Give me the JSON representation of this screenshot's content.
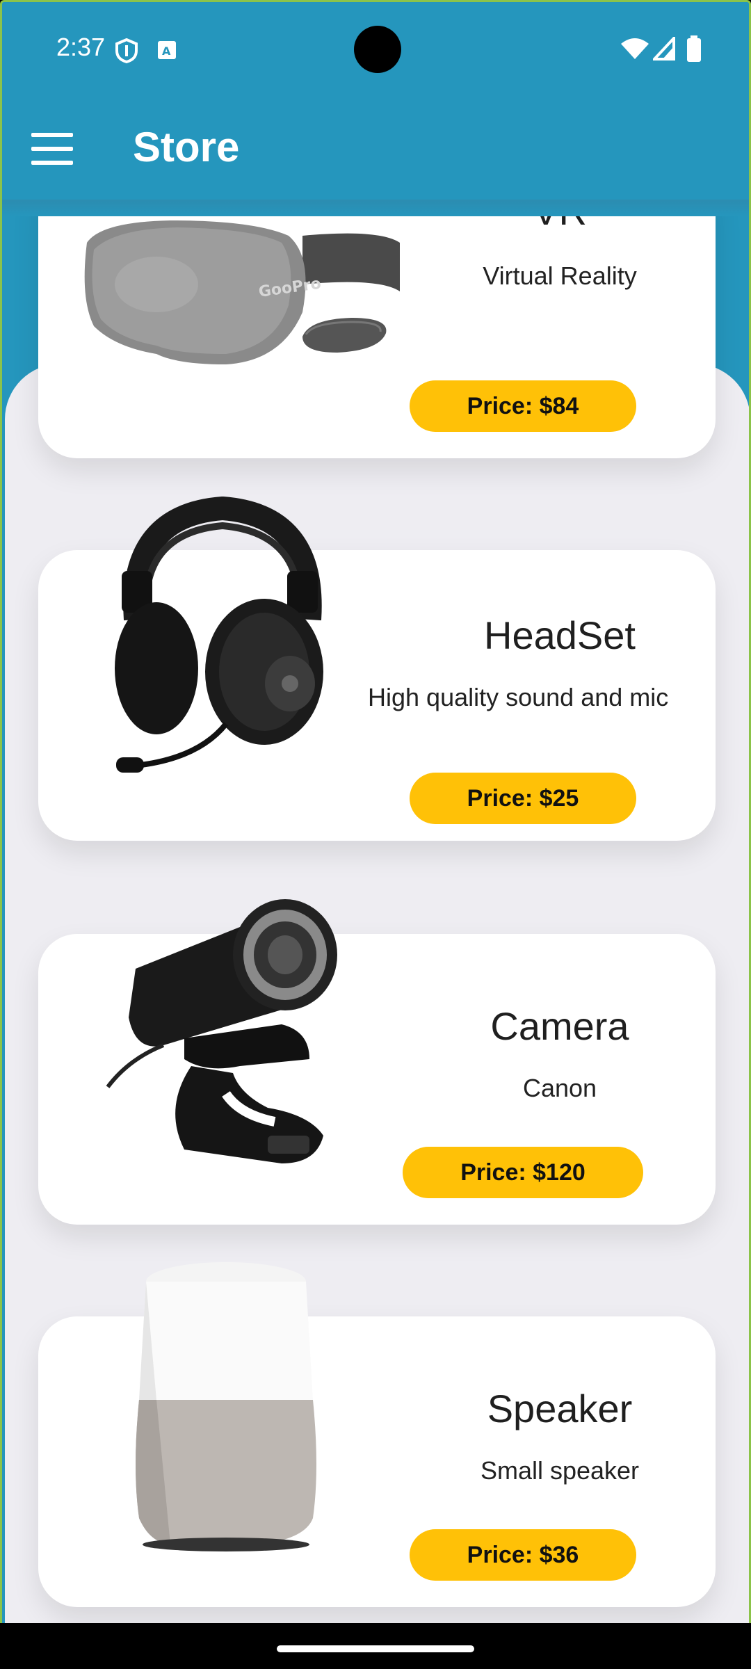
{
  "status_bar": {
    "time": "2:37"
  },
  "app_bar": {
    "title": "Store"
  },
  "products": [
    {
      "name": "VR",
      "description": "Virtual Reality",
      "price": "Price: $84",
      "image_icon": "vr-headset-icon"
    },
    {
      "name": "HeadSet",
      "description": "High quality sound and mic",
      "price": "Price: $25",
      "image_icon": "headset-icon"
    },
    {
      "name": "Camera",
      "description": "Canon",
      "price": "Price: $120",
      "image_icon": "webcam-icon"
    },
    {
      "name": "Speaker",
      "description": "Small speaker",
      "price": "Price: $36",
      "image_icon": "smart-speaker-icon"
    }
  ],
  "colors": {
    "app_bar": "#2596bd",
    "price_button": "#ffc107",
    "content_bg": "#eeedf2",
    "card": "#ffffff"
  }
}
